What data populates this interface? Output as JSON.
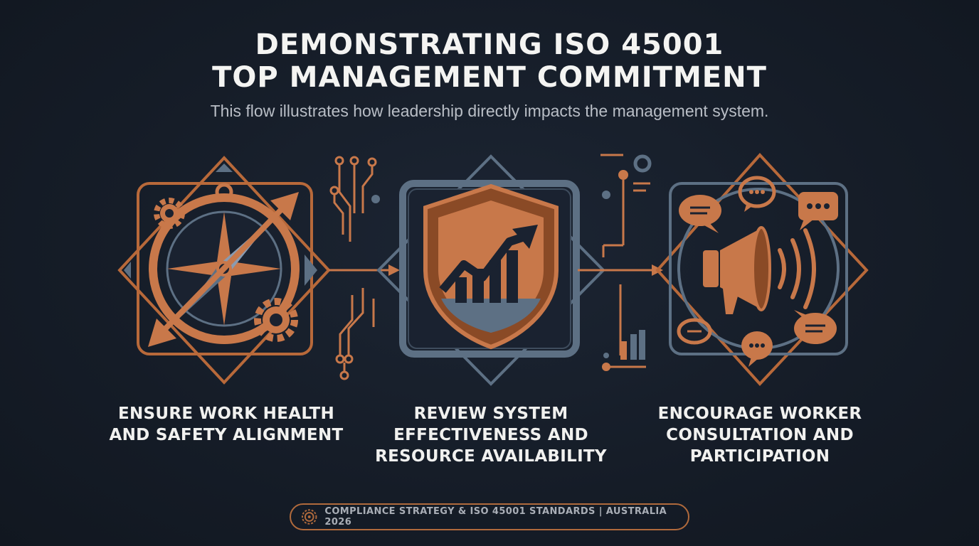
{
  "header": {
    "title_line1": "DEMONSTRATING ISO 45001",
    "title_line2": "TOP MANAGEMENT COMMITMENT",
    "subtitle": "This flow illustrates how leadership directly impacts the management system."
  },
  "steps": [
    {
      "label": "ENSURE WORK HEALTH AND SAFETY ALIGNMENT",
      "icon": "compass-icon"
    },
    {
      "label": "REVIEW SYSTEM EFFECTIVENESS AND RESOURCE AVAILABILITY",
      "icon": "shield-chart-icon"
    },
    {
      "label": "ENCOURAGE WORKER CONSULTATION AND PARTICIPATION",
      "icon": "megaphone-icon"
    }
  ],
  "footer": {
    "text": "COMPLIANCE STRATEGY & ISO 45001 STANDARDS | AUSTRALIA 2026",
    "icon": "seal-icon"
  },
  "colors": {
    "background": "#151c27",
    "accent": "#c8784a",
    "accent_dark": "#8a4a26",
    "steel": "#5d7084",
    "text": "#f4f4f2"
  }
}
